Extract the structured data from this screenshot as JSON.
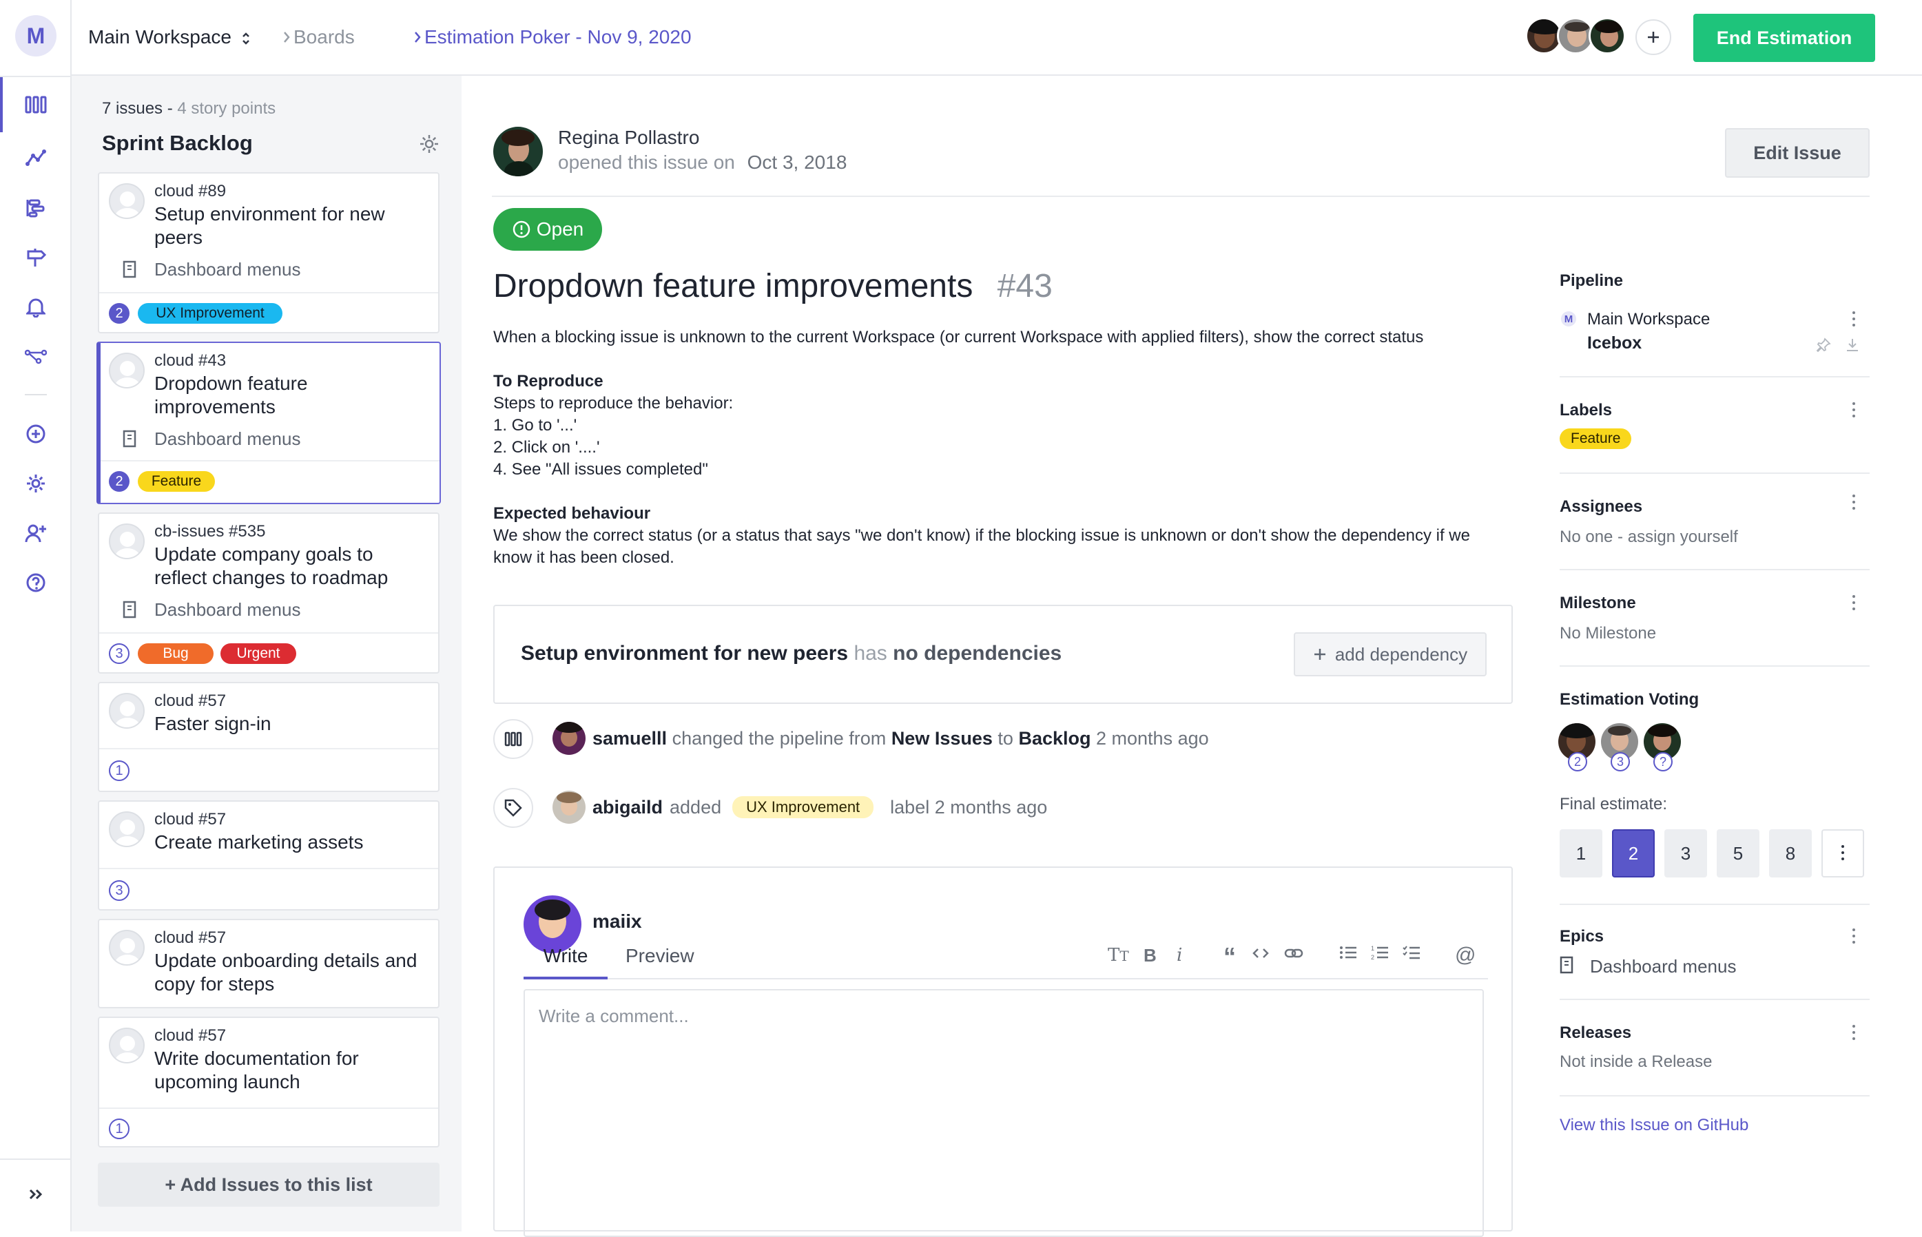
{
  "app": {
    "logo_letter": "M"
  },
  "breadcrumb": {
    "workspace": "Main Workspace",
    "boards": "Boards",
    "current": "Estimation Poker - Nov 9, 2020"
  },
  "header": {
    "end_button": "End Estimation",
    "add_icon": "plus-icon"
  },
  "rail": {
    "items": [
      "board-icon",
      "graph-icon",
      "roadmap-icon",
      "signpost-icon",
      "bell-icon",
      "workflow-icon",
      "add-circle-icon",
      "gear-icon",
      "add-user-icon",
      "help-icon"
    ],
    "collapse": "chevrons-right-icon"
  },
  "backlog": {
    "count_text": "7 issues -",
    "points_text": "4 story points",
    "title": "Sprint Backlog",
    "add_button": "+ Add Issues to this list",
    "cards": [
      {
        "repo": "cloud #89",
        "title": "Setup environment for new peers",
        "epic": "Dashboard menus",
        "points": "2",
        "labels": [
          {
            "text": "UX Improvement",
            "color": "#1ab8f0"
          }
        ]
      },
      {
        "repo": "cloud #43",
        "title": "Dropdown feature improvements",
        "epic": "Dashboard menus",
        "points": "2",
        "labels": [
          {
            "text": "Feature",
            "color": "#f9d71c"
          }
        ]
      },
      {
        "repo": "cb-issues #535",
        "title": "Update company goals to reflect changes to roadmap",
        "epic": "Dashboard menus",
        "points": "3",
        "labels": [
          {
            "text": "Bug",
            "color": "#f06b2a"
          },
          {
            "text": "Urgent",
            "color": "#dc2c32"
          }
        ]
      },
      {
        "repo": "cloud #57",
        "title": "Faster sign-in",
        "points": "1"
      },
      {
        "repo": "cloud #57",
        "title": "Create marketing assets",
        "points": "3"
      },
      {
        "repo": "cloud #57",
        "title": "Update onboarding details and copy for steps"
      },
      {
        "repo": "cloud #57",
        "title": "Write documentation for upcoming launch",
        "points": "1"
      }
    ]
  },
  "issue": {
    "author": "Regina Pollastro",
    "opened_prefix": "opened this issue on",
    "opened_date": "Oct 3, 2018",
    "edit_button": "Edit Issue",
    "status": "Open",
    "title": "Dropdown feature improvements",
    "number": "#43",
    "intro": "When a blocking issue is unknown to the current Workspace (or current Workspace with applied filters), show the correct status",
    "reproduce_heading": "To Reproduce",
    "reproduce_lines": [
      "Steps to reproduce the behavior:",
      "1. Go to '...'",
      "2. Click on '....'",
      "4. See \"All issues completed\""
    ],
    "expected_heading": "Expected behaviour",
    "expected_text": "We show the correct status (or a status that says \"we don't know) if the blocking issue is unknown or don't show the dependency if we know it has been closed.",
    "dependency": {
      "issue": "Setup environment for new peers",
      "has": "has",
      "none": "no dependencies",
      "button": "add dependency"
    },
    "activity": [
      {
        "user": "samuelll",
        "text1": "changed the pipeline from",
        "from": "New Issues",
        "text2": "to",
        "to": "Backlog",
        "time": "2 months ago"
      },
      {
        "user": "abigaild",
        "text1": "added",
        "label": "UX Improvement",
        "text2": "label 2 months ago"
      }
    ],
    "comment": {
      "user": "maiix",
      "tab_write": "Write",
      "tab_preview": "Preview",
      "placeholder": "Write a comment..."
    }
  },
  "sidebar": {
    "pipeline": {
      "heading": "Pipeline",
      "workspace": "Main Workspace",
      "name": "Icebox",
      "ws_letter": "M"
    },
    "labels": {
      "heading": "Labels",
      "value": "Feature"
    },
    "assignees": {
      "heading": "Assignees",
      "value": "No one - assign yourself"
    },
    "milestone": {
      "heading": "Milestone",
      "value": "No Milestone"
    },
    "voting": {
      "heading": "Estimation Voting",
      "votes": [
        "2",
        "3",
        "?"
      ],
      "final_label": "Final estimate:",
      "options": [
        "1",
        "2",
        "3",
        "5",
        "8"
      ],
      "selected": "2"
    },
    "epics": {
      "heading": "Epics",
      "value": "Dashboard menus"
    },
    "releases": {
      "heading": "Releases",
      "value": "Not inside a Release"
    },
    "github_link": "View this Issue on GitHub"
  },
  "colors": {
    "accent": "#5a57c9",
    "green": "#1ec47b",
    "open_green": "#2ba84a"
  }
}
